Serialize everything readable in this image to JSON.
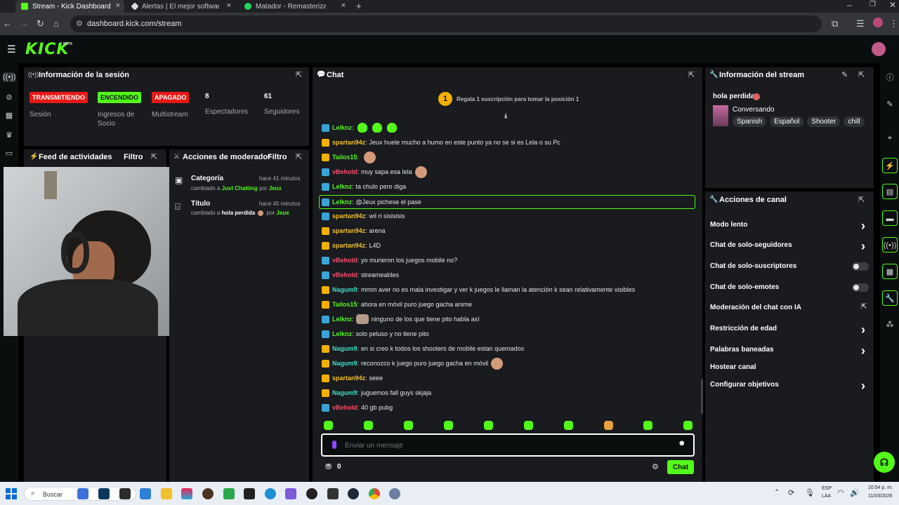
{
  "browser": {
    "tabs": [
      {
        "title": "Stream - Kick Dashboard"
      },
      {
        "title": "Alertas | El mejor software para..."
      },
      {
        "title": "Matador - Remasterizado 2..."
      }
    ],
    "url": "dashboard.kick.com/stream"
  },
  "kick": {
    "logo": "KICK",
    "beta": "BETA"
  },
  "session": {
    "title": "Información de la sesión",
    "badges": [
      {
        "text": "TRANSMITIENDO",
        "label": "Sesión",
        "color": "#e91916"
      },
      {
        "text": "ENCENDIDO",
        "label": "Ingresos de Socio",
        "color": "#53fc18"
      },
      {
        "text": "APAGADO",
        "label": "Multistream",
        "color": "#e91916"
      }
    ],
    "viewers": {
      "value": "8",
      "label": "Espectadores"
    },
    "followers": {
      "value": "61",
      "label": "Seguidores"
    }
  },
  "feed": {
    "title": "Feed de actividades",
    "filter": "Filtro"
  },
  "modactions": {
    "title": "Acciones de moderador",
    "filter": "Filtro",
    "items": [
      {
        "title": "Categoría",
        "time": "hace 41 minutos",
        "prefix": "cambiado a",
        "value": "Just Chatting",
        "by": "por",
        "user": "Jeux"
      },
      {
        "title": "Título",
        "time": "hace 45 minutos",
        "prefix": "cambiado a",
        "value": "hola perdida",
        "by": "por",
        "user": "Jeux"
      }
    ]
  },
  "chat": {
    "title": "Chat",
    "gift_rank": "1",
    "gift_text": "Regala 1 suscripción para tomar la posición 1",
    "messages": [
      {
        "badge": "mod",
        "user": "Lelknz",
        "color": "#53fc18",
        "text": "",
        "emotes": "green3"
      },
      {
        "badge": "vip",
        "user": "spartan94z",
        "color": "#f2c12e",
        "text": "Jeux huele mucho a humo en este punto ya no se si es Lela o su Pc"
      },
      {
        "badge": "vip",
        "user": "Tailos15",
        "color": "#53fc18",
        "text": "",
        "emotes": "face1"
      },
      {
        "badge": "mod",
        "user": "vBehold",
        "color": "#ff4f6b",
        "text": "muy sapa esa lela",
        "emotes": "face1"
      },
      {
        "badge": "mod",
        "user": "Lelknz",
        "color": "#53fc18",
        "text": "ta chulo pero diga"
      },
      {
        "badge": "mod",
        "user": "Lelknz",
        "color": "#53fc18",
        "text": "@Jeux pichese el pase",
        "highlight": true
      },
      {
        "badge": "mod",
        "user": "spartan94z",
        "color": "#f2c12e",
        "text": "wil ri sisisisis"
      },
      {
        "badge": "vip",
        "user": "spartan94z",
        "color": "#f2c12e",
        "text": "arena"
      },
      {
        "badge": "vip",
        "user": "spartan94z",
        "color": "#f2c12e",
        "text": "L4D"
      },
      {
        "badge": "mod",
        "user": "vBehold",
        "color": "#ff4f6b",
        "text": "yo murieron los juegos mobile no?"
      },
      {
        "badge": "mod",
        "user": "vBehold",
        "color": "#ff4f6b",
        "text": "streameables"
      },
      {
        "badge": "vip",
        "user": "Nagum9",
        "color": "#3ee0c5",
        "text": "mmm aver no es mala investigar y ver k juegos le llaman la atención k sean relativamente visibles"
      },
      {
        "badge": "vip",
        "user": "Tailos15",
        "color": "#53fc18",
        "text": "ahora en móvil puro juego gacha anime"
      },
      {
        "badge": "mod",
        "user": "Lelknz",
        "color": "#53fc18",
        "text": "ninguno de los que tiene pito habla así",
        "emotes": "cat"
      },
      {
        "badge": "mod",
        "user": "Lelknz",
        "color": "#53fc18",
        "text": "solo peluso y no tiene pito"
      },
      {
        "badge": "vip",
        "user": "Nagum9",
        "color": "#3ee0c5",
        "text": "en si creo k todos los shooters de mobile estan quemados"
      },
      {
        "badge": "vip",
        "user": "Nagum9",
        "color": "#3ee0c5",
        "text": "reconozco k juego puro juego gacha en móvil",
        "emotes": "face1"
      },
      {
        "badge": "vip",
        "user": "spartan94z",
        "color": "#f2c12e",
        "text": "seee"
      },
      {
        "badge": "vip",
        "user": "Nagum9",
        "color": "#3ee0c5",
        "text": "juguemos fall guys skjaja"
      },
      {
        "badge": "mod",
        "user": "vBehold",
        "color": "#ff4f6b",
        "text": "40 gb pubg"
      }
    ],
    "input_placeholder": "Enviar un mensaje",
    "points": "0",
    "send": "Chat"
  },
  "stream_info": {
    "title": "Información del stream",
    "stream_title": "hola perdida",
    "category": "Conversando",
    "tags": [
      "Spanish",
      "Español",
      "Shooter",
      "chill"
    ]
  },
  "channel_actions": {
    "title": "Acciones de canal",
    "items": [
      {
        "label": "Modo lento",
        "control": "chevron"
      },
      {
        "label": "Chat de solo-seguidores",
        "control": "chevron"
      },
      {
        "label": "Chat de solo-suscriptores",
        "control": "toggle"
      },
      {
        "label": "Chat de solo-emotes",
        "control": "toggle"
      },
      {
        "label": "Moderación del chat con IA",
        "control": "external"
      },
      {
        "label": "Restricción de edad",
        "control": "chevron"
      },
      {
        "label": "Palabras baneadas",
        "control": "chevron"
      },
      {
        "label": "Hostear canal",
        "control": "none"
      },
      {
        "label": "Configurar objetivos",
        "control": "chevron"
      }
    ]
  },
  "taskbar": {
    "search": "Buscar",
    "lang1": "ESP",
    "lang2": "LAA",
    "time": "10:54 p. m.",
    "date": "11/03/2026"
  }
}
